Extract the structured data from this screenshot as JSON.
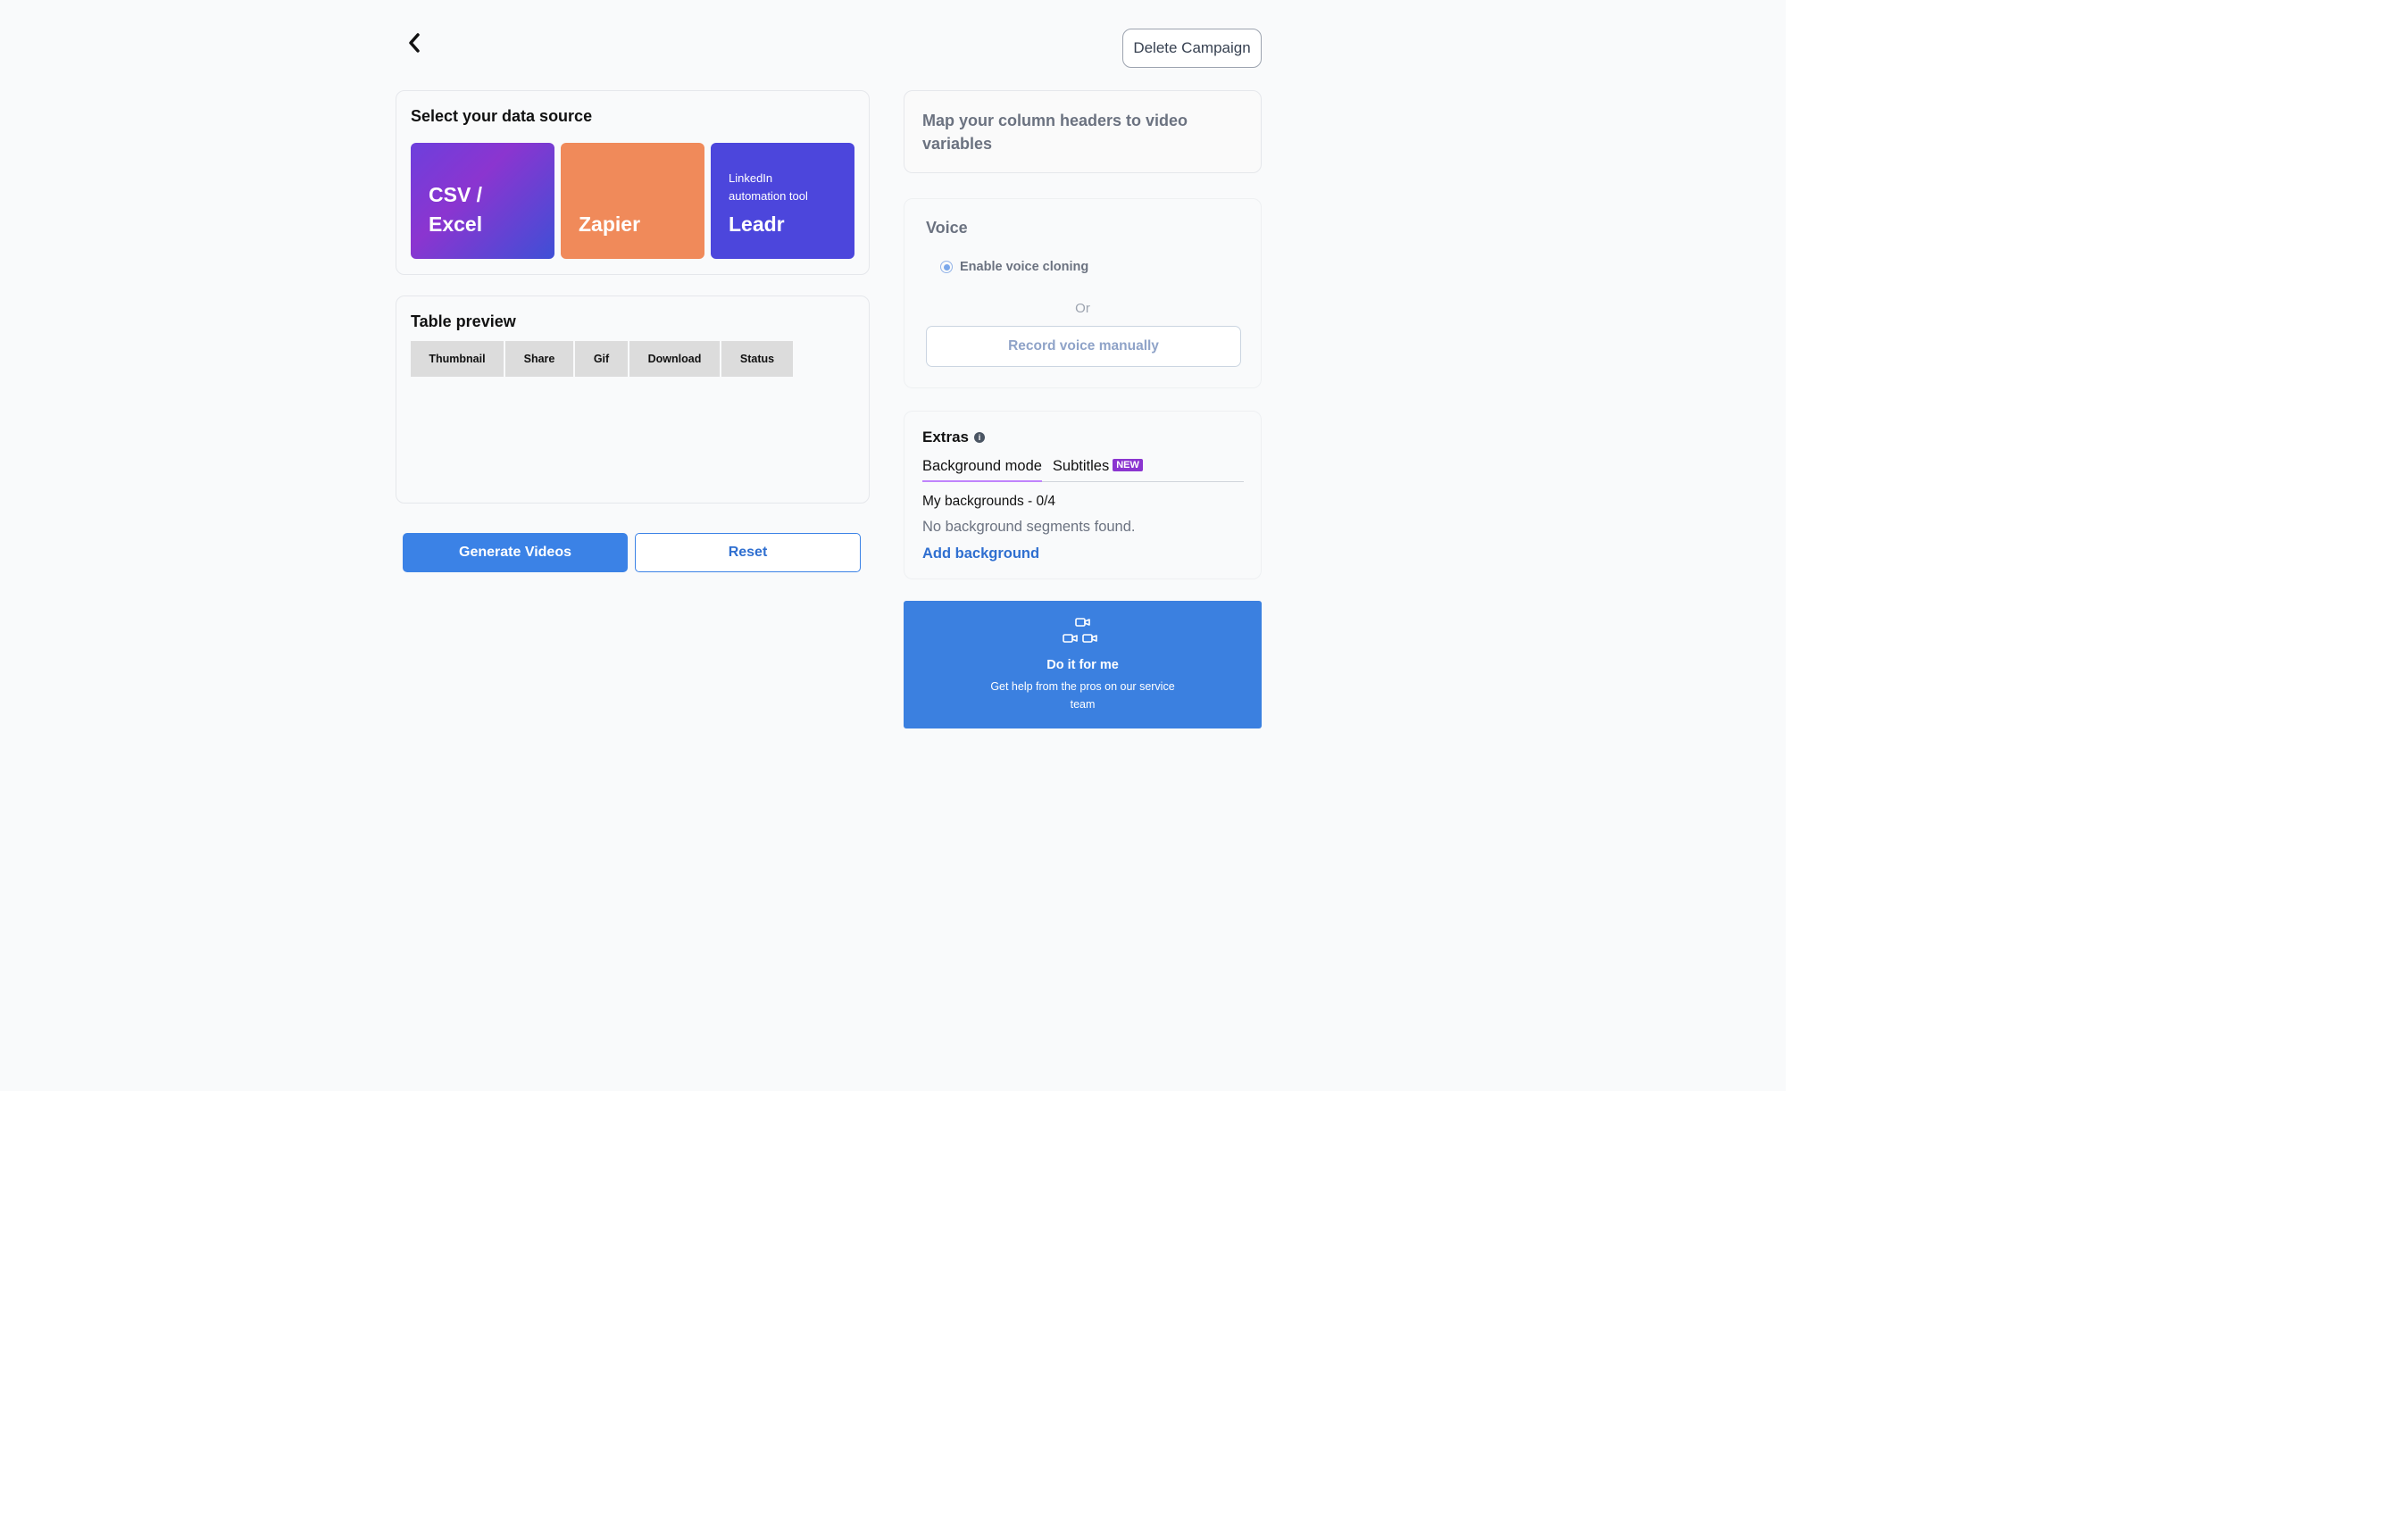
{
  "header": {
    "back_icon": "chevron-left-icon",
    "delete_label": "Delete Campaign"
  },
  "datasource": {
    "title": "Select your data source",
    "tiles": [
      {
        "line1": "CSV /",
        "line2": "Excel",
        "color": "#7b3ad6"
      },
      {
        "label": "Zapier",
        "color": "#f08a5a"
      },
      {
        "caption": "LinkedIn automation tool",
        "label": "Leadr",
        "color": "#4c46dc"
      }
    ]
  },
  "preview": {
    "title": "Table preview",
    "columns": [
      "Thumbnail",
      "Share",
      "Gif",
      "Download",
      "Status"
    ]
  },
  "actions": {
    "generate_label": "Generate Videos",
    "reset_label": "Reset",
    "accent": "#3b82e6"
  },
  "mapping": {
    "text": "Map your column headers to video variables"
  },
  "voice": {
    "title": "Voice",
    "radio_label": "Enable voice cloning",
    "or_label": "Or",
    "record_label": "Record voice manually"
  },
  "extras": {
    "title": "Extras",
    "info_icon": "info-icon",
    "tabs": [
      "Background mode",
      "Subtitles"
    ],
    "new_badge": "NEW",
    "my_backgrounds": "My backgrounds - 0/4",
    "empty_text": "No background segments found.",
    "add_label": "Add background"
  },
  "service": {
    "icon": "video-camera-icon",
    "title": "Do it for me",
    "subtitle": "Get help from the pros on our service team",
    "color": "#3b80e0"
  }
}
